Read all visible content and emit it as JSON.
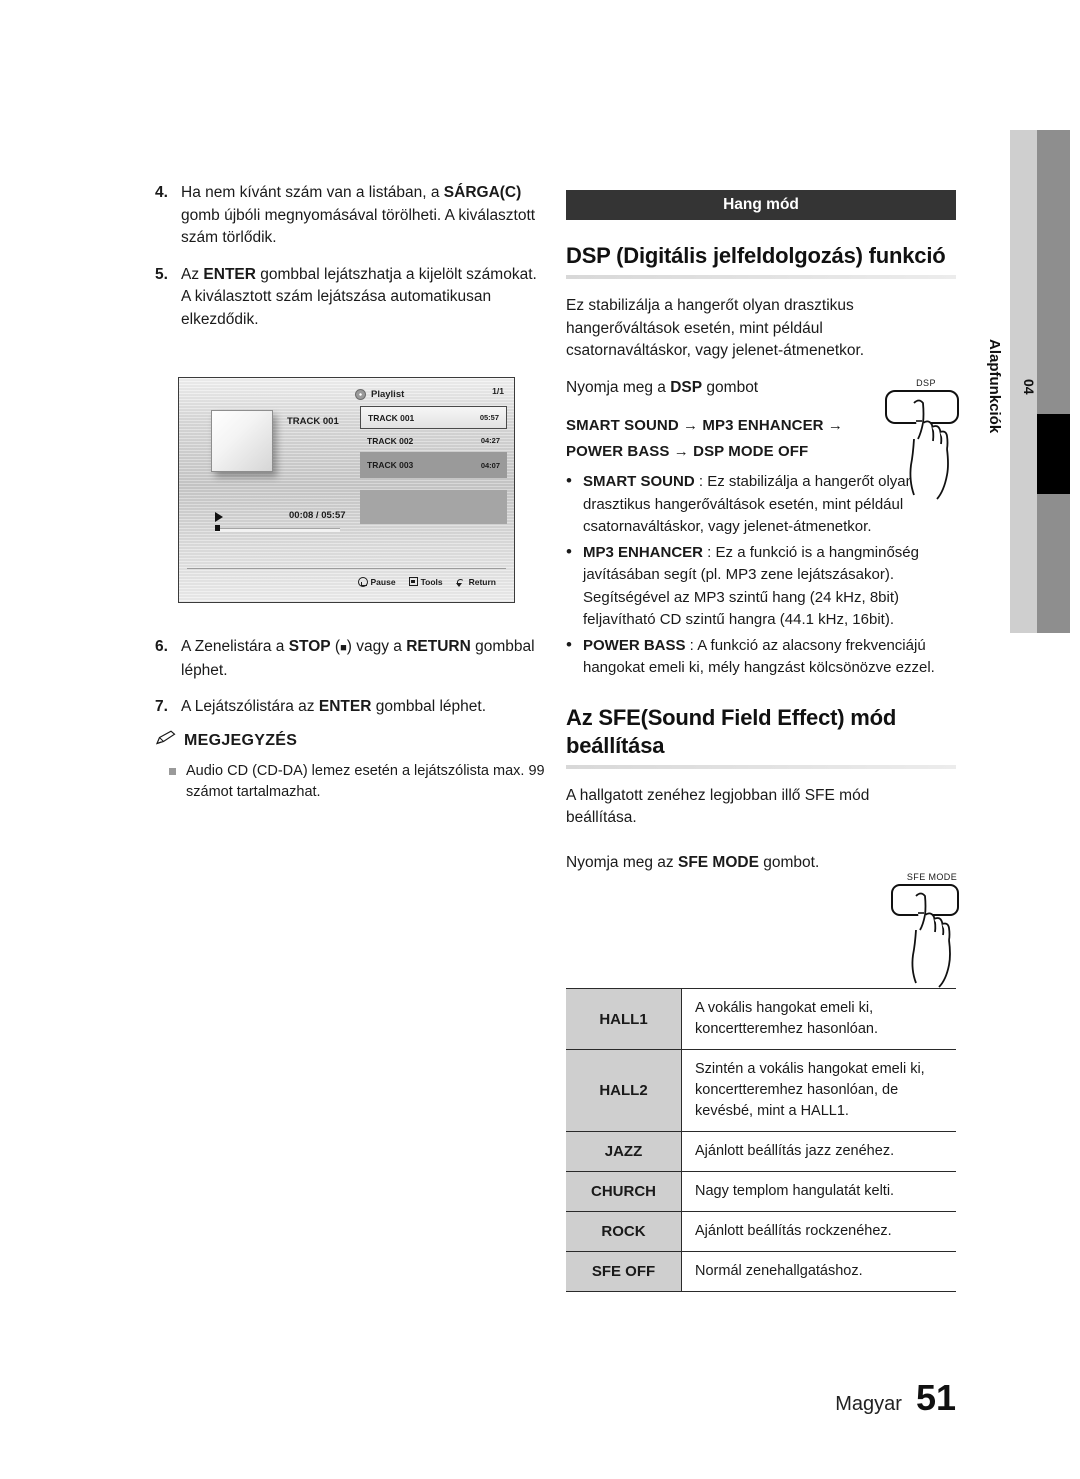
{
  "page": {
    "language_label": "Magyar",
    "page_number": "51"
  },
  "side_tab": {
    "chapter_number": "04",
    "chapter_label": "Alapfunkciók"
  },
  "left_column": {
    "steps": [
      {
        "num": "4.",
        "parts": [
          {
            "t": "Ha nem kívánt szám van a listában, a ",
            "b": false
          },
          {
            "t": "SÁRGA(C)",
            "b": true
          },
          {
            "t": " gomb újbóli megnyomásával törölheti. A kiválasztott szám törlődik.",
            "b": false
          }
        ]
      },
      {
        "num": "5.",
        "parts": [
          {
            "t": "Az ",
            "b": false
          },
          {
            "t": "ENTER",
            "b": true
          },
          {
            "t": " gombbal lejátszhatja a kijelölt számokat.",
            "b": false
          },
          {
            "t": "\nA kiválasztott szám lejátszása automatikusan elkezdődik.",
            "b": false
          }
        ]
      },
      {
        "num": "6.",
        "parts": [
          {
            "t": "A Zenelistára a ",
            "b": false
          },
          {
            "t": "STOP",
            "b": true
          },
          {
            "t": " (■) vagy a ",
            "b": false
          },
          {
            "t": "RETURN",
            "b": true
          },
          {
            "t": " gombbal léphet.",
            "b": false
          }
        ]
      },
      {
        "num": "7.",
        "parts": [
          {
            "t": "A Lejátszólistára az ",
            "b": false
          },
          {
            "t": "ENTER",
            "b": true
          },
          {
            "t": " gombbal léphet.",
            "b": false
          }
        ]
      }
    ],
    "note": {
      "title": "MEGJEGYZÉS",
      "items": [
        "Audio CD (CD-DA) lemez esetén a lejátszólista max. 99 számot tartalmazhat."
      ]
    }
  },
  "screen_mock": {
    "title": "Playlist",
    "page_indicator": "1/1",
    "now_playing_track": "TRACK 001",
    "elapsed_total": "00:08 / 05:57",
    "tracks": [
      {
        "name": "TRACK 001",
        "time": "05:57",
        "state": "selected"
      },
      {
        "name": "TRACK 002",
        "time": "04:27",
        "state": "normal"
      },
      {
        "name": "TRACK 003",
        "time": "04:07",
        "state": "highlight"
      }
    ],
    "footer_buttons": [
      {
        "icon": "enter-icon",
        "label": "Pause"
      },
      {
        "icon": "tools-icon",
        "label": "Tools"
      },
      {
        "icon": "return-icon",
        "label": "Return"
      }
    ]
  },
  "right_column": {
    "section_bar": "Hang mód",
    "dsp": {
      "heading": "DSP (Digitális jelfeldolgozás) funkció",
      "intro": "Ez stabilizálja a hangerőt olyan drasztikus hangerőváltások esetén, mint például csatornaváltáskor, vagy jelenet-átmenetkor.",
      "press_parts": [
        {
          "t": "Nyomja meg a ",
          "b": false
        },
        {
          "t": "DSP",
          "b": true
        },
        {
          "t": " gombot",
          "b": false
        }
      ],
      "chain_line1": "SMART SOUND  → MP3 ENHANCER →",
      "chain_line2": "POWER BASS  →  DSP MODE OFF",
      "button_icon_label": "DSP",
      "bullets": [
        {
          "term": "SMART SOUND",
          "sep": " : ",
          "desc": "Ez stabilizálja a hangerőt olyan drasztikus hangerőváltások esetén, mint például csatornaváltáskor, vagy jelenet-átmenetkor."
        },
        {
          "term": "MP3 ENHANCER",
          "sep": "  : ",
          "desc": "Ez a funkció is a hangminőség javításában segít (pl. MP3 zene lejátszásakor). Segítségével az MP3 szintű hang (24 kHz, 8bit) feljavítható CD szintű hangra (44.1 kHz, 16bit)."
        },
        {
          "term": "POWER BASS",
          "sep": " : ",
          "desc": "A funkció az alacsony frekvenciájú hangokat emeli ki, mély hangzást kölcsönözve ezzel."
        }
      ]
    },
    "sfe": {
      "heading": "Az SFE(Sound Field Effect) mód beállítása",
      "intro": "A hallgatott zenéhez legjobban illő SFE mód beállítása.",
      "press_parts": [
        {
          "t": "Nyomja meg az ",
          "b": false
        },
        {
          "t": "SFE MODE",
          "b": true
        },
        {
          "t": " gombot.",
          "b": false
        }
      ],
      "button_icon_label": "SFE MODE",
      "table": [
        {
          "key": "HALL1",
          "value": "A vokális hangokat emeli ki, koncertteremhez hasonlóan."
        },
        {
          "key": "HALL2",
          "value": "Szintén a vokális hangokat emeli ki, koncertteremhez hasonlóan, de kevésbé, mint a HALL1."
        },
        {
          "key": "JAZZ",
          "value": "Ajánlott beállítás jazz zenéhez."
        },
        {
          "key": "CHURCH",
          "value": "Nagy templom hangulatát kelti."
        },
        {
          "key": "ROCK",
          "value": "Ajánlott beállítás rockzenéhez."
        },
        {
          "key": "SFE OFF",
          "value": "Normál zenehallgatáshoz."
        }
      ]
    }
  },
  "colors": {
    "section_bar_bg": "#343434",
    "table_key_bg": "#cfcfcf",
    "side_tab_bg": "#cfcfcf",
    "side_bar_bg": "#8e8e8e",
    "side_marker": "#000000"
  }
}
